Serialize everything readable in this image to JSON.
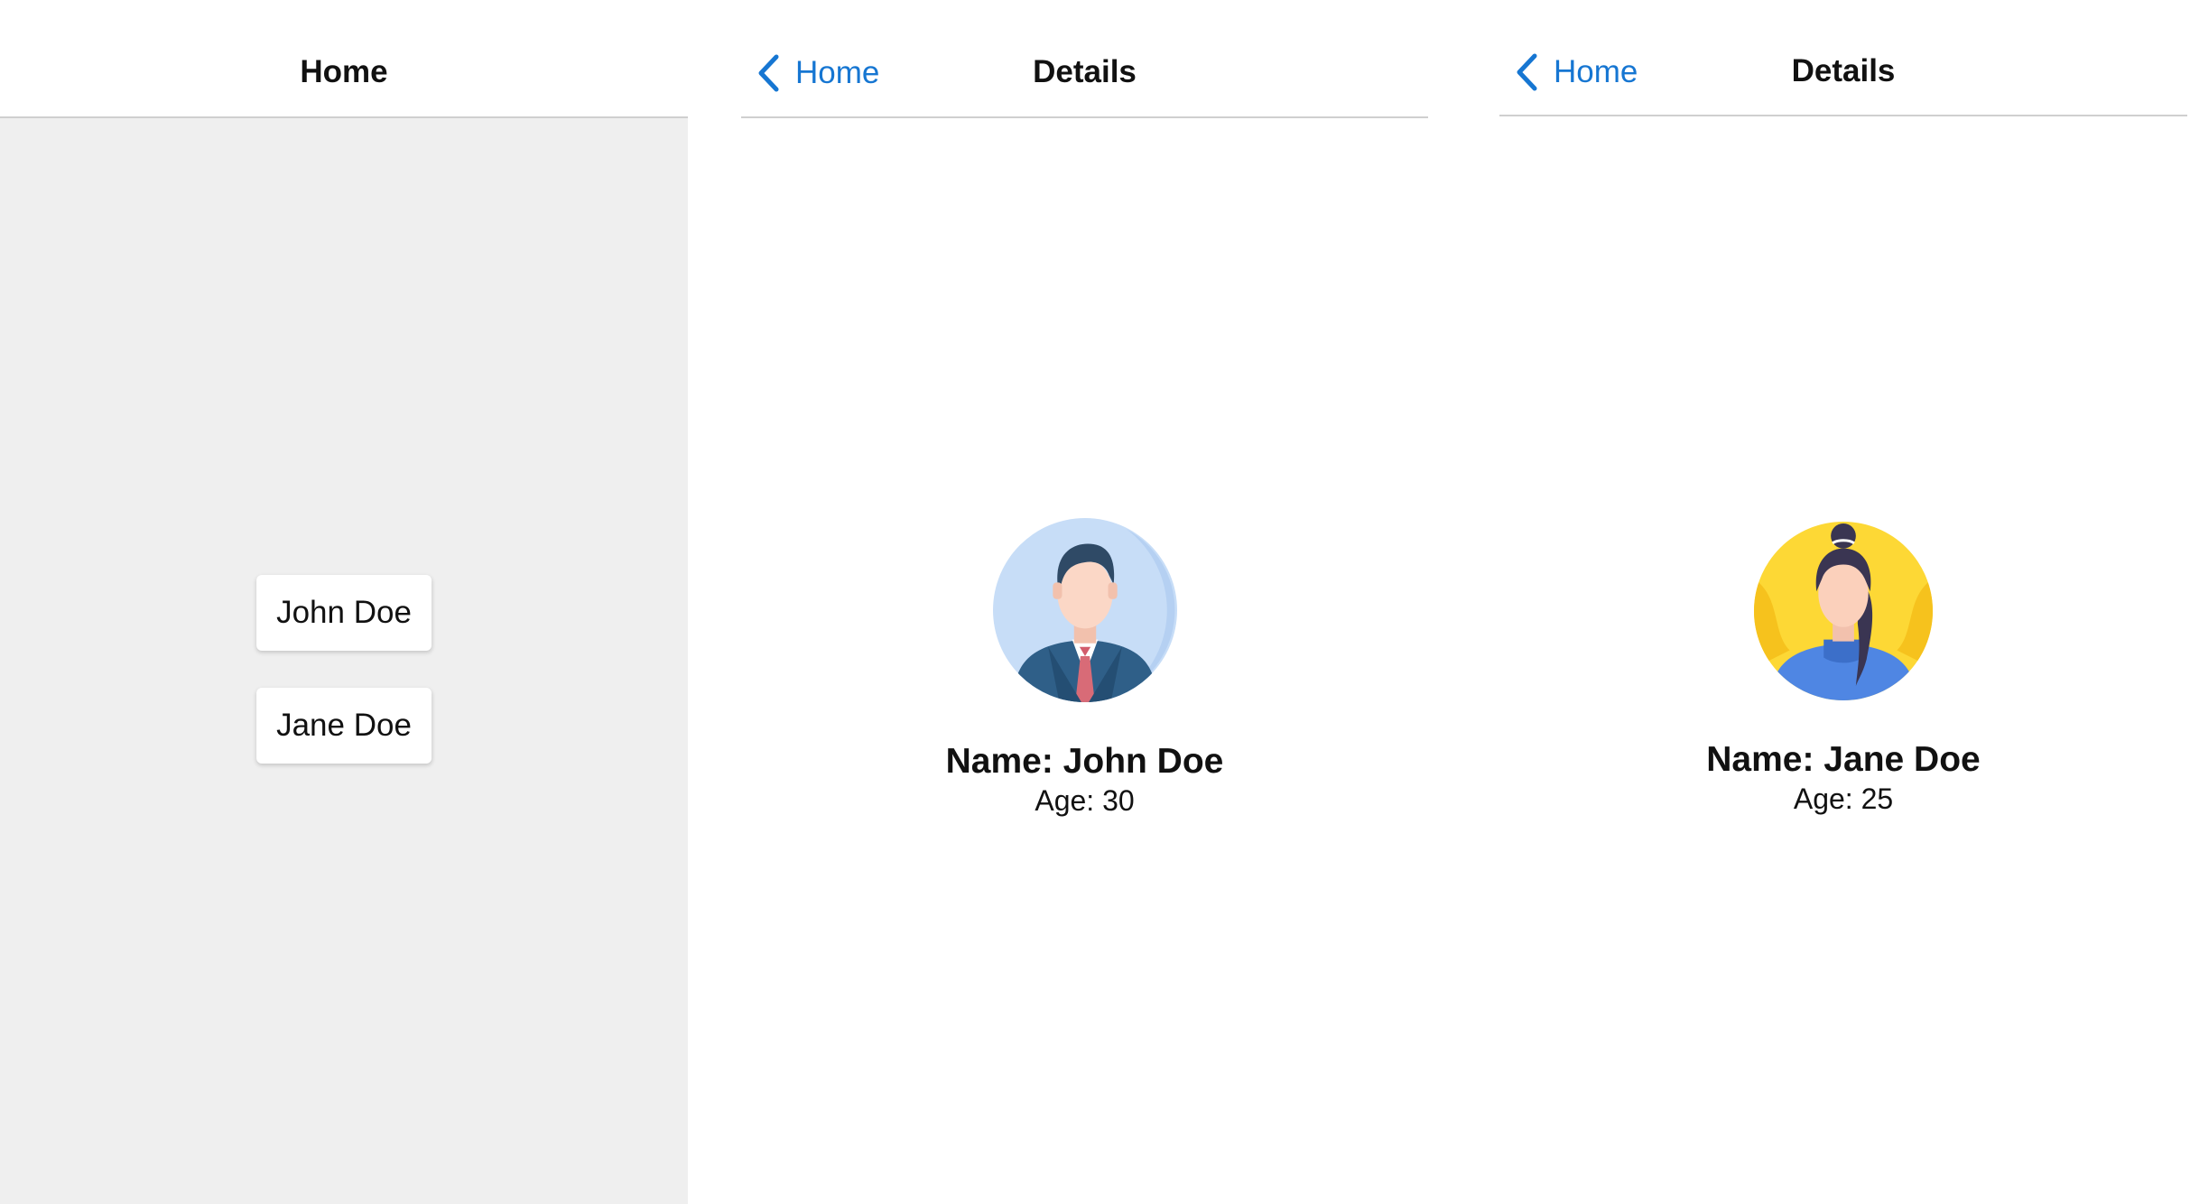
{
  "screens": {
    "home": {
      "title": "Home",
      "people": [
        {
          "label": "John Doe"
        },
        {
          "label": "Jane Doe"
        }
      ]
    },
    "details_john": {
      "back_label": "Home",
      "title": "Details",
      "avatar_icon": "man-avatar-icon",
      "name_text": "Name: John Doe",
      "age_text": "Age: 30"
    },
    "details_jane": {
      "back_label": "Home",
      "title": "Details",
      "avatar_icon": "woman-avatar-icon",
      "name_text": "Name: Jane Doe",
      "age_text": "Age: 25"
    }
  },
  "colors": {
    "accent": "#1676d2",
    "home_background": "#efefef",
    "nav_background": "#ffffff",
    "divider": "#cfcfcf"
  }
}
